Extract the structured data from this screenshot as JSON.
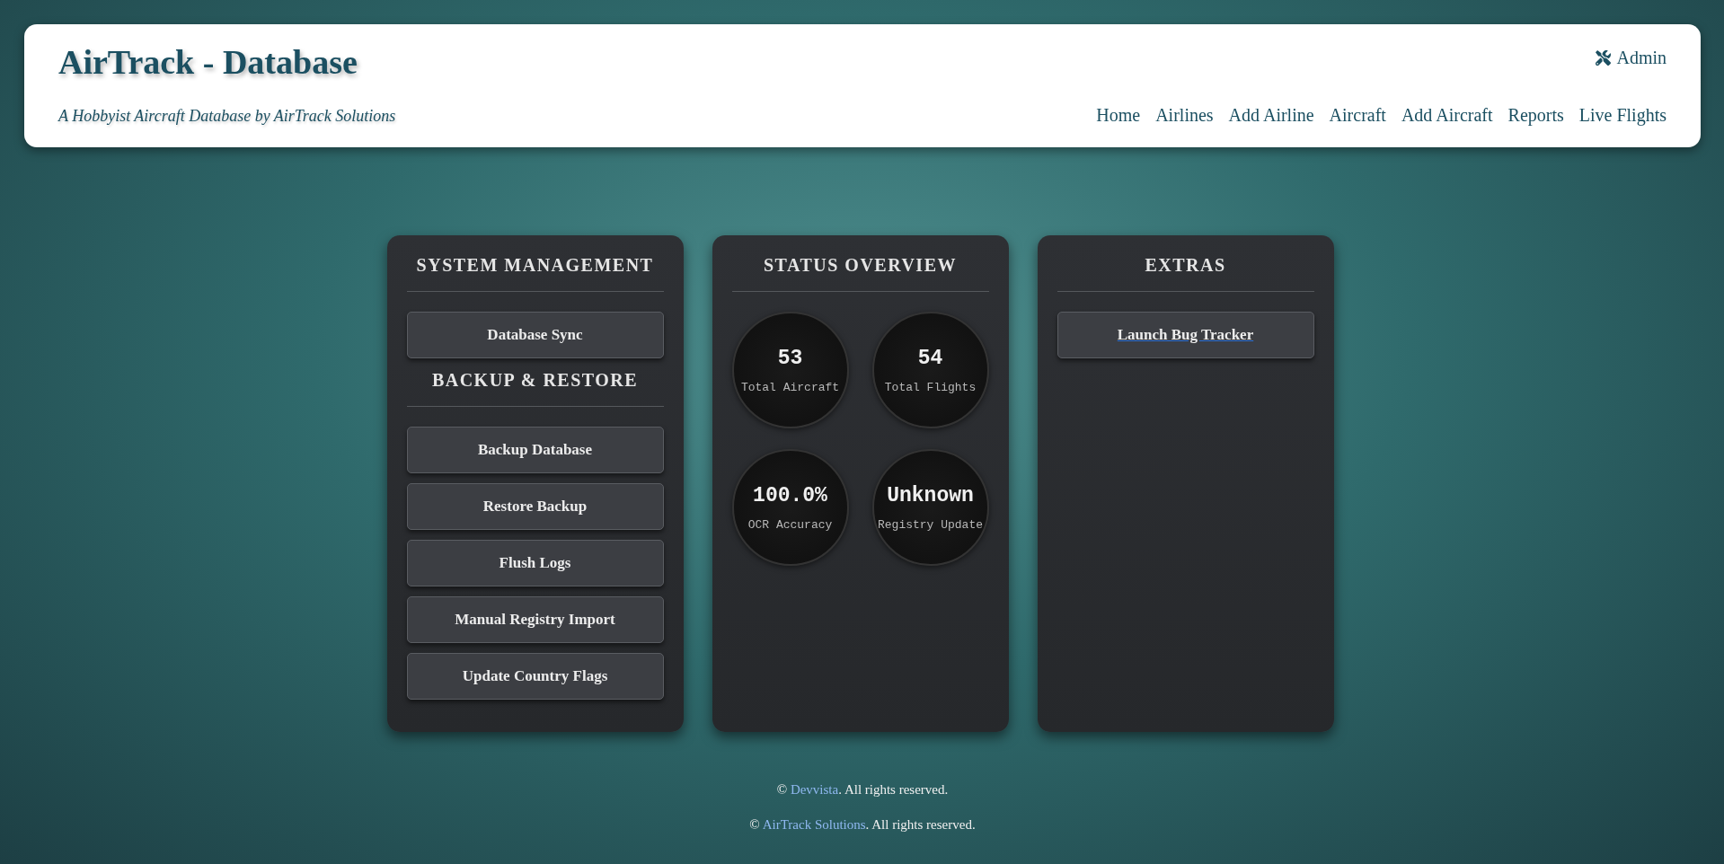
{
  "header": {
    "title": "AirTrack - Database",
    "subtitle": "A Hobbyist Aircraft Database by AirTrack Solutions",
    "admin_link": "Admin",
    "nav": [
      "Home",
      "Airlines",
      "Add Airline",
      "Aircraft",
      "Add Aircraft",
      "Reports",
      "Live Flights"
    ]
  },
  "panels": [
    {
      "kind": "actions",
      "sections": [
        {
          "title": "SYSTEM MANAGEMENT",
          "buttons": [
            {
              "label": "Database Sync",
              "kind": "button"
            }
          ]
        },
        {
          "title": "BACKUP & RESTORE",
          "buttons": [
            {
              "label": "Backup Database",
              "kind": "button"
            },
            {
              "label": "Restore Backup",
              "kind": "button"
            },
            {
              "label": "Flush Logs",
              "kind": "button"
            },
            {
              "label": "Manual Registry Import",
              "kind": "button"
            },
            {
              "label": "Update Country Flags",
              "kind": "button"
            }
          ]
        }
      ]
    },
    {
      "kind": "stats",
      "title": "STATUS OVERVIEW",
      "stats": [
        {
          "value": "53",
          "label": "Total Aircraft"
        },
        {
          "value": "54",
          "label": "Total Flights"
        },
        {
          "value": "100.0%",
          "label": "OCR Accuracy"
        },
        {
          "value": "Unknown",
          "label": "Registry Update"
        }
      ]
    },
    {
      "kind": "actions",
      "sections": [
        {
          "title": "EXTRAS",
          "buttons": [
            {
              "label": "Launch Bug Tracker",
              "kind": "link"
            }
          ]
        }
      ]
    }
  ],
  "footer": [
    {
      "prefix": "©",
      "link": "Devvista",
      "suffix": ". All rights reserved."
    },
    {
      "prefix": "©",
      "link": "AirTrack Solutions",
      "suffix": ". All rights reserved."
    }
  ]
}
